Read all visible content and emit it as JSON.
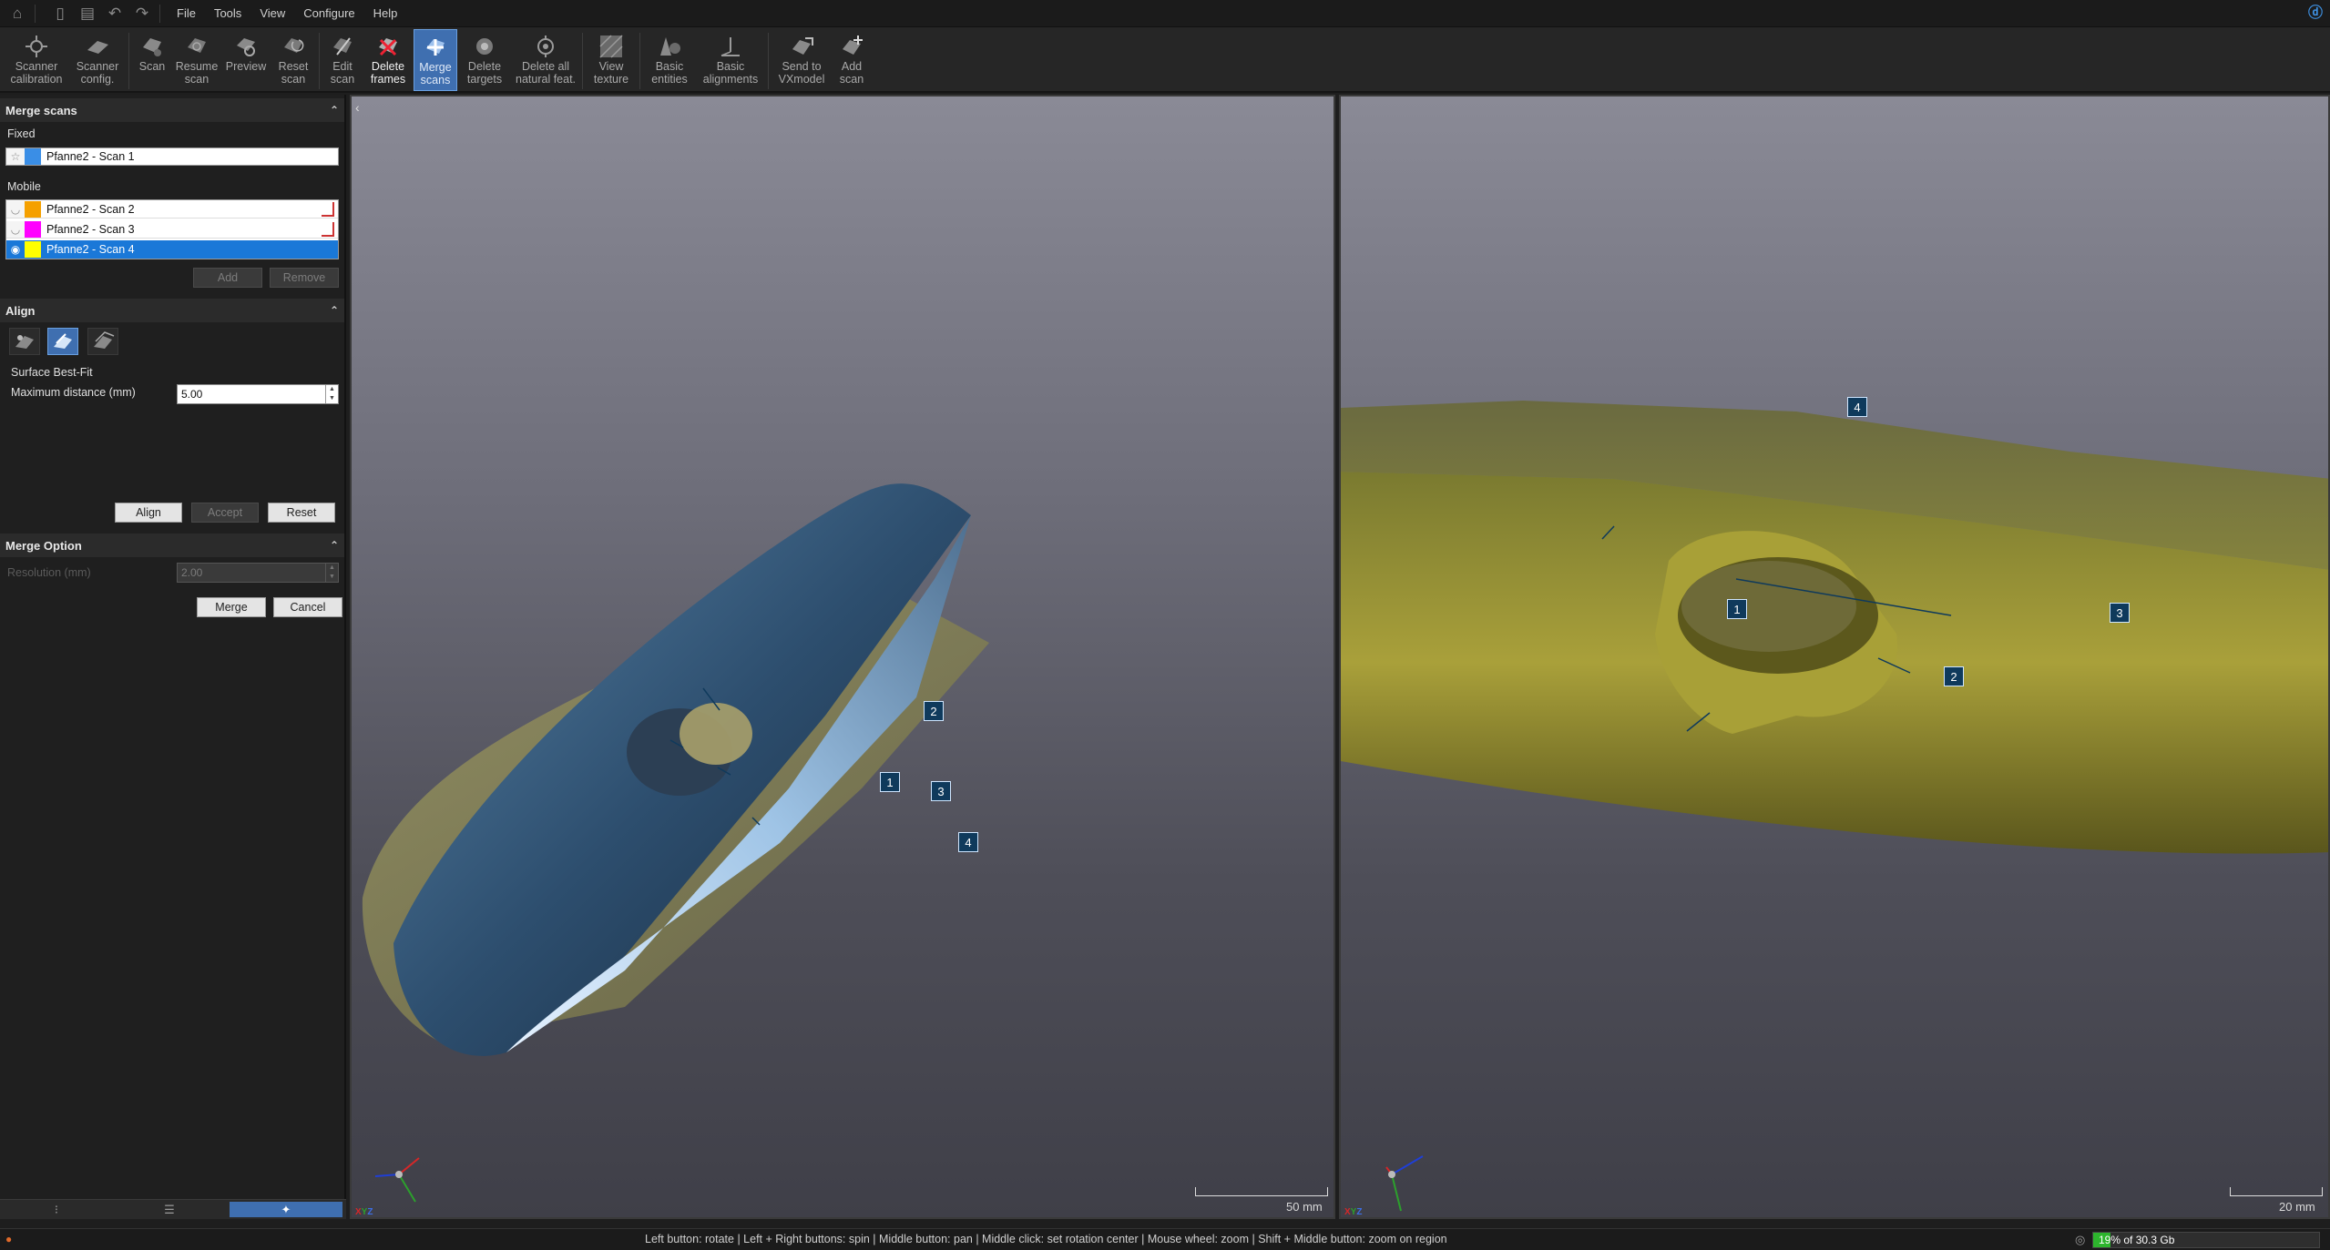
{
  "menu": {
    "items": [
      "File",
      "Tools",
      "View",
      "Configure",
      "Help"
    ],
    "quick_access_icons": [
      "home-icon",
      "new-file-icon",
      "save-icon",
      "undo-icon",
      "redo-icon"
    ]
  },
  "ribbon": {
    "buttons": [
      {
        "id": "scanner-calibration",
        "label": "Scanner\ncalibration",
        "icon": "scanner-calibration-icon",
        "state": "normal"
      },
      {
        "id": "scanner-config",
        "label": "Scanner\nconfig.",
        "icon": "scanner-config-icon",
        "state": "normal"
      },
      {
        "id": "scan",
        "label": "Scan",
        "icon": "scan-icon",
        "state": "normal"
      },
      {
        "id": "resume-scan",
        "label": "Resume\nscan",
        "icon": "resume-scan-icon",
        "state": "normal"
      },
      {
        "id": "preview",
        "label": "Preview",
        "icon": "preview-icon",
        "state": "normal"
      },
      {
        "id": "reset-scan",
        "label": "Reset\nscan",
        "icon": "reset-scan-icon",
        "state": "normal"
      },
      {
        "id": "edit-scan",
        "label": "Edit\nscan",
        "icon": "edit-scan-icon",
        "state": "normal"
      },
      {
        "id": "delete-frames",
        "label": "Delete\nframes",
        "icon": "delete-frames-icon",
        "state": "bright"
      },
      {
        "id": "merge-scans",
        "label": "Merge\nscans",
        "icon": "merge-scans-icon",
        "state": "active"
      },
      {
        "id": "delete-targets",
        "label": "Delete\ntargets",
        "icon": "delete-targets-icon",
        "state": "normal"
      },
      {
        "id": "delete-natural-features",
        "label": "Delete all\nnatural feat.",
        "icon": "delete-natural-features-icon",
        "state": "normal"
      },
      {
        "id": "view-texture",
        "label": "View\ntexture",
        "icon": "view-texture-icon",
        "state": "normal"
      },
      {
        "id": "basic-entities",
        "label": "Basic\nentities",
        "icon": "basic-entities-icon",
        "state": "normal"
      },
      {
        "id": "basic-alignments",
        "label": "Basic\nalignments",
        "icon": "basic-alignments-icon",
        "state": "normal"
      },
      {
        "id": "send-to-vxmodel",
        "label": "Send to\nVXmodel",
        "icon": "send-to-vxmodel-icon",
        "state": "normal"
      },
      {
        "id": "add-scan",
        "label": "Add\nscan",
        "icon": "add-scan-icon",
        "state": "normal"
      }
    ]
  },
  "merge_scans": {
    "title": "Merge scans",
    "fixed_label": "Fixed",
    "fixed_scan": {
      "name": "Pfanne2 - Scan 1",
      "color": "#3a8ee6"
    },
    "mobile_label": "Mobile",
    "mobile_scans": [
      {
        "name": "Pfanne2 - Scan 2",
        "color": "#f5a000",
        "selected": false
      },
      {
        "name": "Pfanne2 - Scan 3",
        "color": "#ff00ff",
        "selected": false
      },
      {
        "name": "Pfanne2 - Scan 4",
        "color": "#ffff00",
        "selected": true
      }
    ],
    "add_label": "Add",
    "remove_label": "Remove"
  },
  "align": {
    "title": "Align",
    "method_label": "Surface Best-Fit",
    "max_distance_label": "Maximum distance (mm)",
    "max_distance_value": "5.00",
    "align_label": "Align",
    "accept_label": "Accept",
    "reset_label": "Reset"
  },
  "merge_option": {
    "title": "Merge Option",
    "resolution_label": "Resolution (mm)",
    "resolution_value": "2.00",
    "merge_label": "Merge",
    "cancel_label": "Cancel"
  },
  "viewports": {
    "left": {
      "scale_label": "50 mm",
      "markers": [
        "1",
        "2",
        "3",
        "4"
      ],
      "axis_tag": "XYZ"
    },
    "right": {
      "scale_label": "20 mm",
      "markers": [
        "1",
        "2",
        "3",
        "4"
      ],
      "axis_tag": "XYZ"
    }
  },
  "status": {
    "hint": "Left button: rotate  |  Left + Right buttons: spin  |  Middle button: pan  |  Middle click: set rotation center  |  Mouse wheel: zoom  |  Shift + Middle button: zoom on region",
    "memory_label": "19% of 30.3 Gb",
    "memory_percent": 19,
    "memory_color": "#2db52d"
  }
}
